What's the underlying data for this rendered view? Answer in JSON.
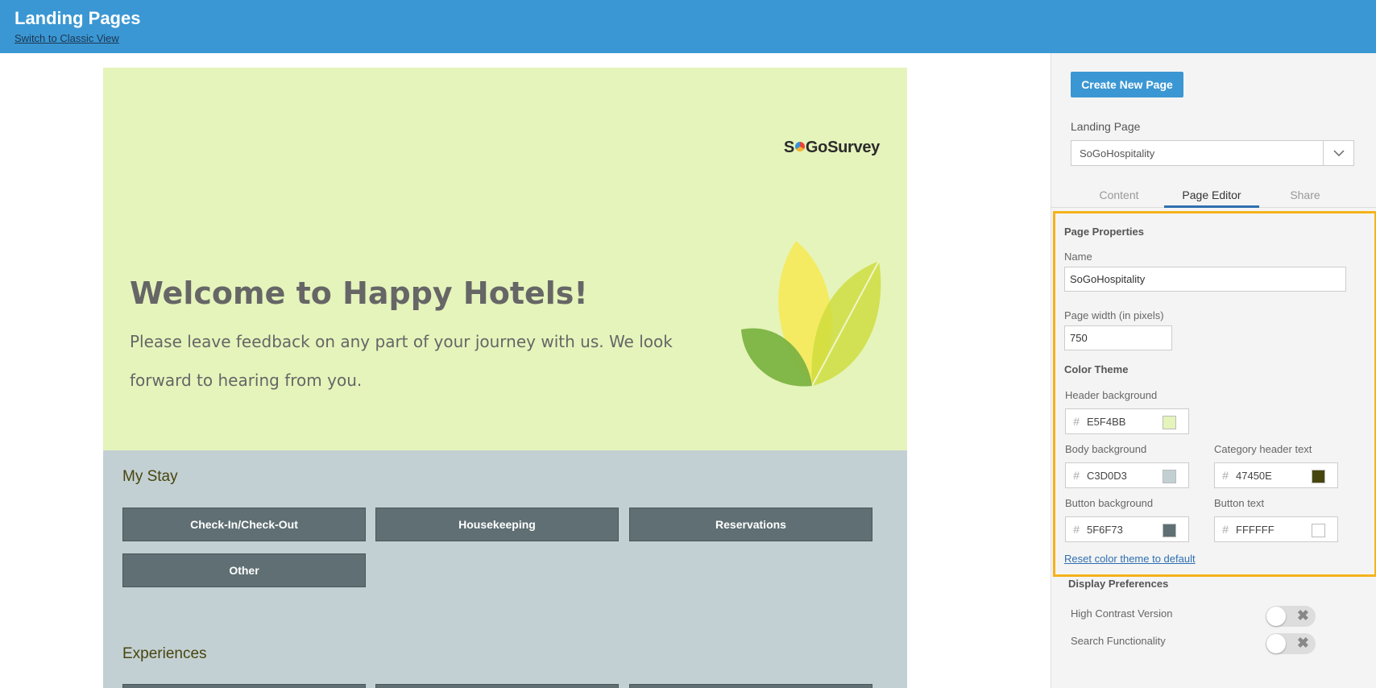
{
  "header": {
    "title": "Landing Pages",
    "classic_link": "Switch to Classic View",
    "color": "#3b97d3"
  },
  "preview": {
    "logo": {
      "pre": "S",
      "post": "GoSurvey",
      "icon": "sogosurvey-logo"
    },
    "welcome": "Welcome to Happy Hotels!",
    "subtitle": "Please leave feedback on any part of your journey with us. We look forward to hearing from you.",
    "leaves_icon": "leaves-graphic",
    "categories": [
      {
        "title": "My Stay",
        "buttons": [
          "Check-In/Check-Out",
          "Housekeeping",
          "Reservations",
          "Other"
        ]
      },
      {
        "title": "Experiences",
        "buttons": []
      }
    ]
  },
  "panel": {
    "create_button": "Create New Page",
    "landing_page_label": "Landing Page",
    "landing_page_value": "SoGoHospitality",
    "tabs": [
      "Content",
      "Page Editor",
      "Share"
    ],
    "active_tab": "Page Editor",
    "page_properties": {
      "title": "Page Properties",
      "name_label": "Name",
      "name_value": "SoGoHospitality",
      "width_label": "Page width (in pixels)",
      "width_value": "750",
      "color_theme_title": "Color Theme",
      "colors": {
        "header_bg": {
          "label": "Header background",
          "hex": "E5F4BB",
          "swatch": "#E5F4BB"
        },
        "body_bg": {
          "label": "Body background",
          "hex": "C3D0D3",
          "swatch": "#C3D0D3"
        },
        "cat_header_text": {
          "label": "Category header text",
          "hex": "47450E",
          "swatch": "#47450E"
        },
        "button_bg": {
          "label": "Button background",
          "hex": "5F6F73",
          "swatch": "#5F6F73"
        },
        "button_text": {
          "label": "Button text",
          "hex": "FFFFFF",
          "swatch": "#FFFFFF"
        }
      },
      "reset_link": "Reset color theme to default"
    },
    "display_preferences": {
      "title": "Display Preferences",
      "high_contrast": {
        "label": "High Contrast Version",
        "on": false
      },
      "search": {
        "label": "Search Functionality",
        "on": false
      }
    },
    "highlight_color": "#f5b21b"
  }
}
